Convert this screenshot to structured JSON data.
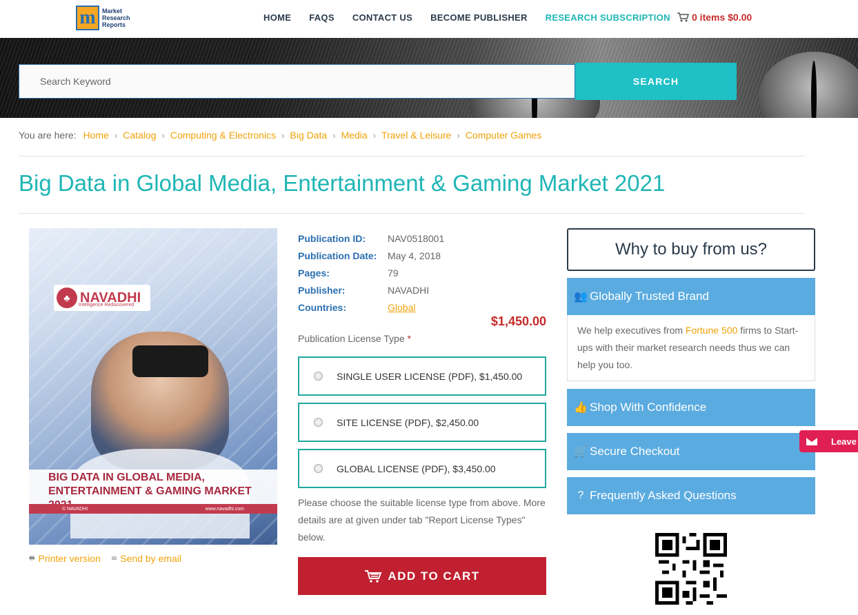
{
  "header": {
    "logo_lines": [
      "Market",
      "Research",
      "Reports"
    ],
    "logo_letter": "m",
    "nav": [
      {
        "label": "HOME"
      },
      {
        "label": "FAQS"
      },
      {
        "label": "CONTACT US"
      },
      {
        "label": "BECOME PUBLISHER"
      },
      {
        "label": "RESEARCH SUBSCRIPTION"
      }
    ],
    "cart_text": "0 items $0.00",
    "accent_color": "#1fb5b5"
  },
  "search": {
    "placeholder": "Search Keyword",
    "button_label": "SEARCH"
  },
  "breadcrumb": {
    "lead": "You are here:",
    "items": [
      "Home",
      "Catalog",
      "Computing & Electronics",
      "Big Data",
      "Media",
      "Travel & Leisure",
      "Computer Games"
    ]
  },
  "page_title": "Big Data in Global Media, Entertainment & Gaming Market 2021",
  "cover": {
    "brand": "NAVADHI",
    "tagline": "Intelligence Rediscovered",
    "title_line1": "BIG DATA IN GLOBAL MEDIA,",
    "title_line2": "ENTERTAINMENT & GAMING MARKET 2021",
    "footer_left": "© NAVADHI",
    "footer_right": "www.navadhi.com"
  },
  "links": {
    "printer": "Printer version",
    "email": "Send by email"
  },
  "meta": [
    {
      "key": "Publication ID:",
      "value": "NAV0518001"
    },
    {
      "key": "Publication Date:",
      "value": "May 4, 2018"
    },
    {
      "key": "Pages:",
      "value": "79"
    },
    {
      "key": "Publisher:",
      "value": "NAVADHI"
    },
    {
      "key": "Countries:",
      "value": "Global"
    }
  ],
  "price": "$1,450.00",
  "license": {
    "label": "Publication License Type",
    "required_mark": "*",
    "options": [
      {
        "label": "SINGLE USER LICENSE (PDF), $1,450.00"
      },
      {
        "label": "SITE LICENSE (PDF), $2,450.00"
      },
      {
        "label": "GLOBAL LICENSE (PDF), $3,450.00"
      }
    ],
    "note": "Please choose the suitable license type from above. More details are at given under tab \"Report License Types\" below."
  },
  "add_to_cart": "ADD TO CART",
  "why": {
    "title": "Why to buy from us?",
    "trusted_title": "Globally Trusted Brand",
    "trusted_pre": "We help executives from ",
    "trusted_highlight": "Fortune 500",
    "trusted_post": " firms to Start-ups with their market research needs thus we can help you too.",
    "confidence_title": "Shop With Confidence",
    "checkout_title": "Secure Checkout",
    "faq_title": "Frequently Asked Questions"
  },
  "leave_tab": "Leave"
}
